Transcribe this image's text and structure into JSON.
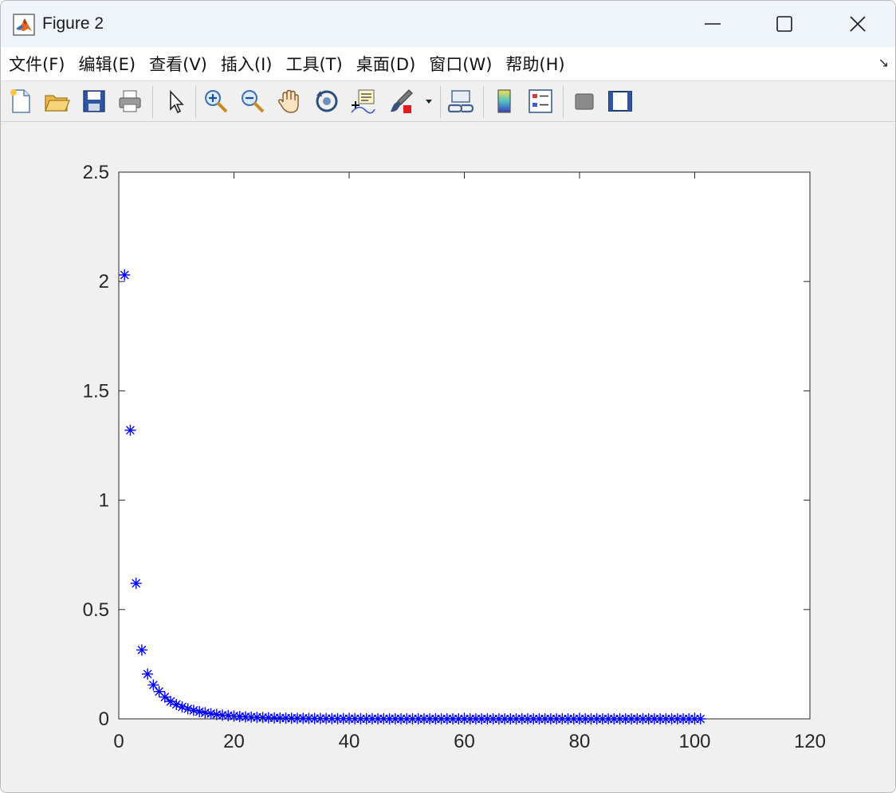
{
  "window": {
    "title": "Figure 2",
    "controls": [
      "minimize-icon",
      "maximize-icon",
      "close-icon"
    ]
  },
  "menubar": {
    "items": [
      {
        "label": "文件(F)"
      },
      {
        "label": "编辑(E)"
      },
      {
        "label": "查看(V)"
      },
      {
        "label": "插入(I)"
      },
      {
        "label": "工具(T)"
      },
      {
        "label": "桌面(D)"
      },
      {
        "label": "窗口(W)"
      },
      {
        "label": "帮助(H)"
      }
    ],
    "dock_arrow": "↘"
  },
  "toolbar": {
    "tools": [
      "new-figure-icon",
      "open-file-icon",
      "save-icon",
      "print-icon",
      "select-pointer-icon",
      "zoom-in-icon",
      "zoom-out-icon",
      "pan-hand-icon",
      "rotate-3d-icon",
      "data-cursor-icon",
      "brush-icon",
      "brush-dropdown-icon",
      "link-plot-icon",
      "colorbar-icon",
      "legend-icon",
      "hide-plot-tools-icon",
      "show-plot-tools-icon"
    ]
  },
  "chart_data": {
    "type": "scatter",
    "marker": "*",
    "color": "#0000ff",
    "title": "",
    "xlabel": "",
    "ylabel": "",
    "xlim": [
      0,
      120
    ],
    "ylim": [
      0,
      2.5
    ],
    "xticks": [
      "0",
      "20",
      "40",
      "60",
      "80",
      "100",
      "120"
    ],
    "yticks": [
      "0",
      "0.5",
      "1",
      "1.5",
      "2",
      "2.5"
    ],
    "grid": false,
    "box": true,
    "series": [
      {
        "x": [
          1,
          2,
          3,
          4,
          5,
          6,
          7,
          8,
          9,
          10,
          11,
          12,
          13,
          14,
          15,
          16,
          17,
          18,
          19,
          20,
          21,
          22,
          23,
          24,
          25,
          26,
          27,
          28,
          29,
          30,
          31,
          32,
          33,
          34,
          35,
          36,
          37,
          38,
          39,
          40,
          41,
          42,
          43,
          44,
          45,
          46,
          47,
          48,
          49,
          50,
          51,
          52,
          53,
          54,
          55,
          56,
          57,
          58,
          59,
          60,
          61,
          62,
          63,
          64,
          65,
          66,
          67,
          68,
          69,
          70,
          71,
          72,
          73,
          74,
          75,
          76,
          77,
          78,
          79,
          80,
          81,
          82,
          83,
          84,
          85,
          86,
          87,
          88,
          89,
          90,
          91,
          92,
          93,
          94,
          95,
          96,
          97,
          98,
          99,
          100,
          101
        ],
        "y": [
          2.03,
          1.32,
          0.62,
          0.315,
          0.205,
          0.155,
          0.125,
          0.1,
          0.08,
          0.066,
          0.055,
          0.046,
          0.039,
          0.033,
          0.028,
          0.024,
          0.02,
          0.017,
          0.015,
          0.013,
          0.011,
          0.0095,
          0.0082,
          0.0071,
          0.0061,
          0.0053,
          0.0046,
          0.004,
          0.0035,
          0.003,
          0.0026,
          0.0023,
          0.002,
          0.0017,
          0.0015,
          0.0013,
          0.0011,
          0.001,
          0.0009,
          0.0008,
          0.0007,
          0.0006,
          0.0005,
          0.0005,
          0.0004,
          0.0004,
          0.0003,
          0.0003,
          0.0003,
          0.0002,
          0.0002,
          0.0002,
          0.0002,
          0.0001,
          0.0001,
          0.0001,
          0.0001,
          0.0001,
          0.0001,
          0.0001,
          0.0001,
          0,
          0,
          0,
          0,
          0,
          0,
          0,
          0,
          0,
          0,
          0,
          0,
          0,
          0,
          0,
          0,
          0,
          0,
          0,
          0,
          0,
          0,
          0,
          0,
          0,
          0,
          0,
          0,
          0,
          0,
          0,
          0,
          0,
          0,
          0,
          0,
          0,
          0,
          0,
          0
        ]
      }
    ]
  }
}
